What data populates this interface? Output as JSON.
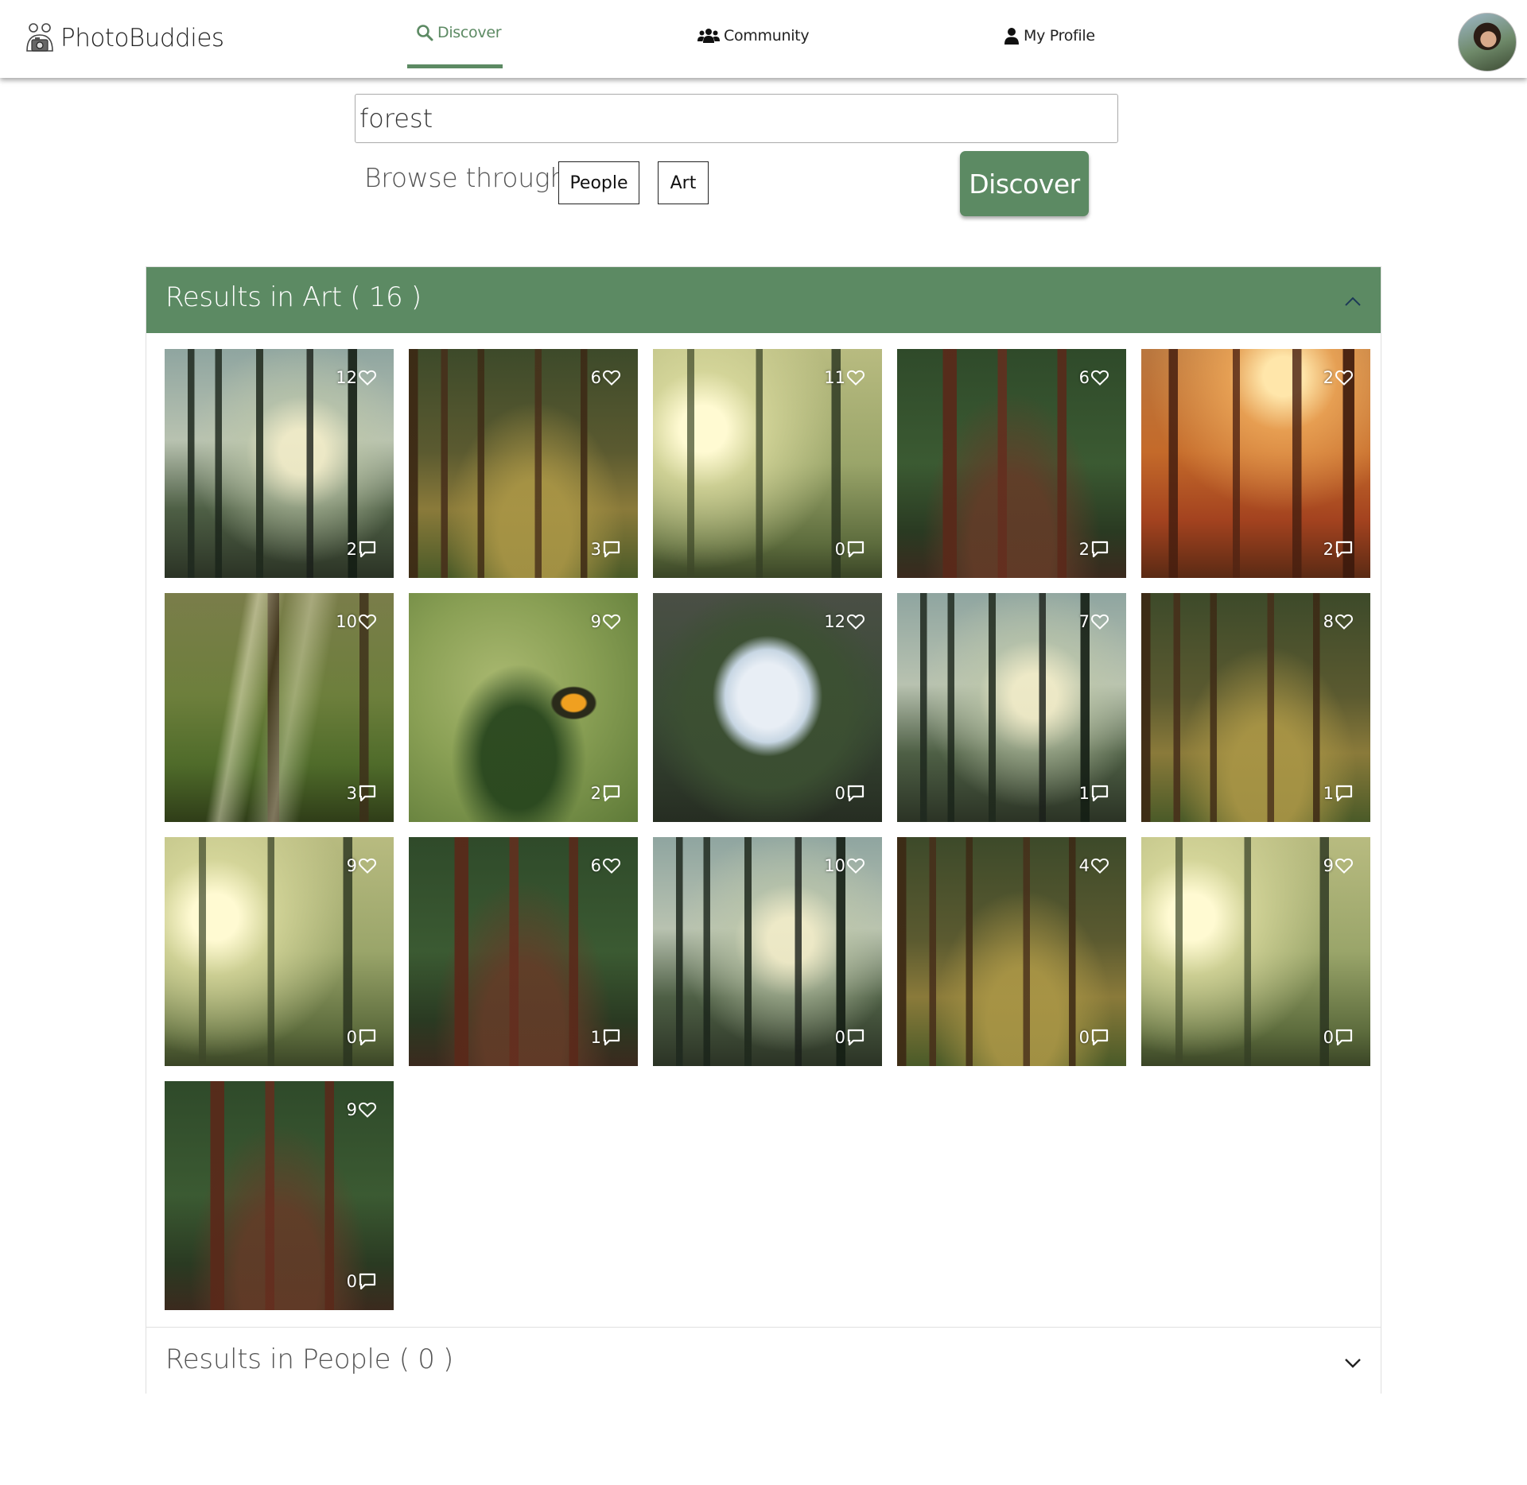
{
  "brand": {
    "name": "PhotoBuddies"
  },
  "nav": {
    "items": [
      {
        "label": "Discover",
        "icon": "search-icon",
        "active": true
      },
      {
        "label": "Community",
        "icon": "users-icon",
        "active": false
      },
      {
        "label": "My Profile",
        "icon": "user-icon",
        "active": false
      }
    ]
  },
  "search": {
    "value": "forest"
  },
  "browse": {
    "label": "Browse through",
    "filters": [
      "People",
      "Art"
    ],
    "submit_label": "Discover"
  },
  "colors": {
    "accent": "#5c8a63"
  },
  "results_art": {
    "title": "Results in Art ( 16 )",
    "expanded": true,
    "items": [
      {
        "likes": "12",
        "comments": "2",
        "scene": "forest-misty"
      },
      {
        "likes": "6",
        "comments": "3",
        "scene": "forest-path-gold"
      },
      {
        "likes": "11",
        "comments": "0",
        "scene": "forest-sunbeam"
      },
      {
        "likes": "6",
        "comments": "2",
        "scene": "forest-redwood"
      },
      {
        "likes": "2",
        "comments": "2",
        "scene": "forest-autumn"
      },
      {
        "likes": "10",
        "comments": "3",
        "scene": "forest-glade"
      },
      {
        "likes": "9",
        "comments": "2",
        "scene": "bird-green"
      },
      {
        "likes": "12",
        "comments": "0",
        "scene": "canopy-sky"
      },
      {
        "likes": "7",
        "comments": "1",
        "scene": "forest-misty"
      },
      {
        "likes": "8",
        "comments": "1",
        "scene": "forest-path-gold"
      },
      {
        "likes": "9",
        "comments": "0",
        "scene": "forest-sunbeam"
      },
      {
        "likes": "6",
        "comments": "1",
        "scene": "forest-redwood"
      },
      {
        "likes": "10",
        "comments": "0",
        "scene": "forest-misty"
      },
      {
        "likes": "4",
        "comments": "0",
        "scene": "forest-path-gold"
      },
      {
        "likes": "9",
        "comments": "0",
        "scene": "forest-sunbeam"
      },
      {
        "likes": "9",
        "comments": "0",
        "scene": "forest-redwood"
      }
    ]
  },
  "results_people": {
    "title": "Results in People ( 0 )",
    "expanded": false
  }
}
